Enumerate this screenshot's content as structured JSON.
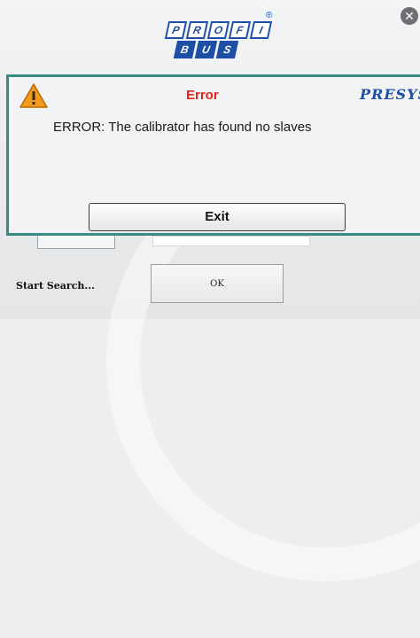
{
  "background": {
    "logo": {
      "top_row": [
        "P",
        "R",
        "O",
        "F",
        "I"
      ],
      "bottom_row": [
        "B",
        "U",
        "S"
      ],
      "registered": "®"
    },
    "close_glyph": "✕",
    "start_search_label": "Start Search...",
    "ok_label": "OK"
  },
  "dialog": {
    "title": "Error",
    "brand": "PRESYS",
    "message": "ERROR: The calibrator has found no slaves",
    "exit_label": "Exit",
    "icon": "warning-icon"
  },
  "colors": {
    "error_title": "#e2231a",
    "brand": "#1e4fa6",
    "dialog_border": "#3a8a86",
    "warning_fill": "#f29a1f"
  }
}
